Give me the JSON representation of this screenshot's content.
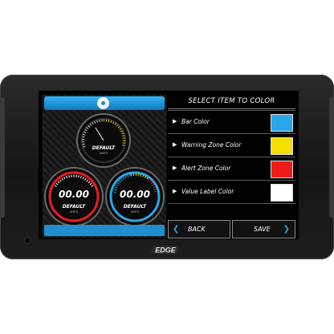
{
  "brand": {
    "logo_text": "EDGE"
  },
  "right_panel": {
    "title": "SELECT ITEM TO COLOR",
    "items": [
      {
        "label": "Bar Color",
        "color": "#2aa7ea"
      },
      {
        "label": "Warning Zone Color",
        "color": "#f5de00"
      },
      {
        "label": "Alert Zone Color",
        "color": "#ee1b1b"
      },
      {
        "label": "Value Label Color",
        "color": "#ffffff"
      }
    ],
    "back_label": "BACK",
    "save_label": "SAVE"
  },
  "gauges": [
    {
      "id": "top",
      "value": "",
      "label": "DEFAULT",
      "unit": "UNITS",
      "accent": "#f5c400"
    },
    {
      "id": "left",
      "value": "00.00",
      "label": "DEFAULT",
      "unit": "UNITS",
      "accent": "#ee1b1b"
    },
    {
      "id": "right",
      "value": "00.00",
      "label": "DEFAULT",
      "unit": "UNITS",
      "accent": "#2aa7ea"
    }
  ],
  "colors": {
    "accent_blue": "#1fa8ee",
    "bezel": "#1b1b1b"
  }
}
